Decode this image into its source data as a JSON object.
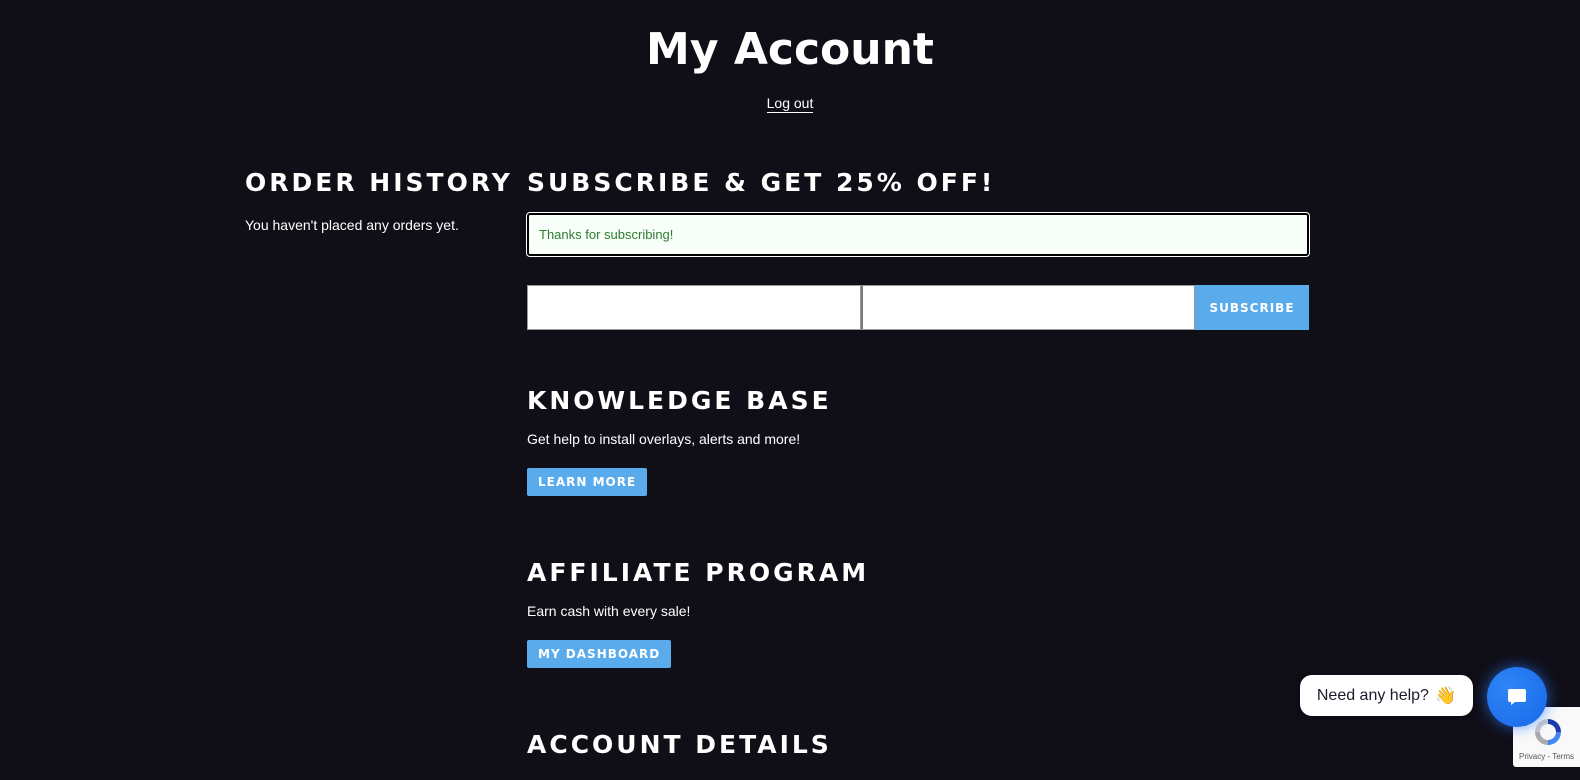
{
  "header": {
    "title": "My Account",
    "logout_label": "Log out"
  },
  "order_history": {
    "heading": "Order History",
    "empty_text": "You haven't placed any orders yet."
  },
  "subscribe": {
    "heading": "Subscribe & Get 25% Off!",
    "success_message": "Thanks for subscribing!",
    "first_input_value": "",
    "second_input_value": "",
    "button_label": "Subscribe"
  },
  "knowledge_base": {
    "heading": "Knowledge Base",
    "description": "Get help to install overlays, alerts and more!",
    "button_label": "Learn More"
  },
  "affiliate": {
    "heading": "Affiliate Program",
    "description": "Earn cash with every sale!",
    "button_label": "My Dashboard"
  },
  "account_details": {
    "heading": "Account Details"
  },
  "chat_widget": {
    "prompt": "Need any help?",
    "emoji": "👋"
  },
  "recaptcha": {
    "privacy": "Privacy",
    "separator": " - ",
    "terms": "Terms"
  },
  "colors": {
    "background": "#100f18",
    "accent_button": "#5aabeb",
    "success_text": "#2e7d32",
    "chat_blue": "#1e6ff0"
  }
}
